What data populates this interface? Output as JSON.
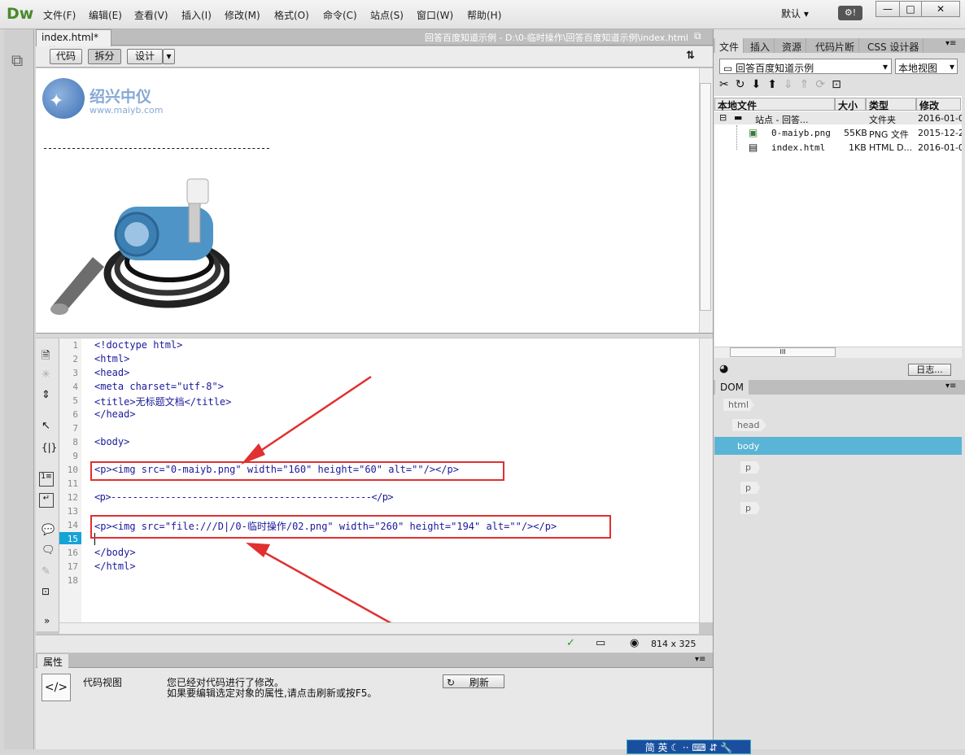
{
  "app": {
    "logo": "Dw",
    "preset": "默认",
    "k_label": "⚙!"
  },
  "menu": [
    "文件(F)",
    "编辑(E)",
    "查看(V)",
    "插入(I)",
    "修改(M)",
    "格式(O)",
    "命令(C)",
    "站点(S)",
    "窗口(W)",
    "帮助(H)"
  ],
  "window_buttons": [
    "—",
    "□",
    "✕"
  ],
  "document": {
    "tab": "index.html*",
    "close": "×",
    "path": "回答百度知道示例 - D:\\0-临时操作\\回答百度知道示例\\index.html"
  },
  "views": {
    "code": "代码",
    "split": "拆分",
    "design": "设计"
  },
  "design_view": {
    "logo_cn": "绍兴中仪",
    "logo_url": "www.maiyb.com",
    "dashes": "------------------------------------------------"
  },
  "code": {
    "line_numbers": [
      "1",
      "2",
      "3",
      "4",
      "5",
      "6",
      "7",
      "8",
      "9",
      "10",
      "11",
      "12",
      "13",
      "14",
      "15",
      "16",
      "17",
      "18"
    ],
    "lines": [
      "<!doctype html>",
      "<html>",
      "<head>",
      "<meta charset=\"utf-8\">",
      "<title>无标题文档</title>",
      "</head>",
      "",
      "<body>",
      "",
      "<p><img src=\"0-maiyb.png\" width=\"160\" height=\"60\" alt=\"\"/></p>",
      "",
      "<p>------------------------------------------------</p>",
      "",
      "<p><img src=\"file:///D|/0-临时操作/02.png\" width=\"260\" height=\"194\" alt=\"\"/></p>",
      "",
      "</body>",
      "</html>",
      ""
    ],
    "current_line": "15"
  },
  "status": {
    "size": "814 x 325"
  },
  "properties": {
    "title": "属性",
    "code_view": "代码视图",
    "msg1": "您已经对代码进行了修改。",
    "msg2": "如果要编辑选定对象的属性,请点击刷新或按F5。",
    "refresh": "刷新"
  },
  "right_panel": {
    "tabs": [
      "文件",
      "插入",
      "资源",
      "代码片断",
      "CSS 设计器"
    ],
    "site": "回答百度知道示例",
    "view": "本地视图",
    "headers": [
      "本地文件",
      "大小",
      "类型",
      "修改"
    ],
    "files": [
      {
        "name": "站点 - 回答...",
        "size": "",
        "type": "文件夹",
        "date": "2016-01-0"
      },
      {
        "name": "0-maiyb.png",
        "size": "55KB",
        "type": "PNG 文件",
        "date": "2015-12-2"
      },
      {
        "name": "index.html",
        "size": "1KB",
        "type": "HTML D...",
        "date": "2016-01-0"
      }
    ],
    "log_button": "日志...",
    "dom_tab": "DOM",
    "dom": [
      "html",
      "head",
      "body",
      "p",
      "p",
      "p"
    ]
  },
  "ime": "简 英 ☾ ·· ⌨ ⇵ 🔧",
  "colors": {
    "accent": "#5ab4d6",
    "annotation": "#e03030"
  }
}
